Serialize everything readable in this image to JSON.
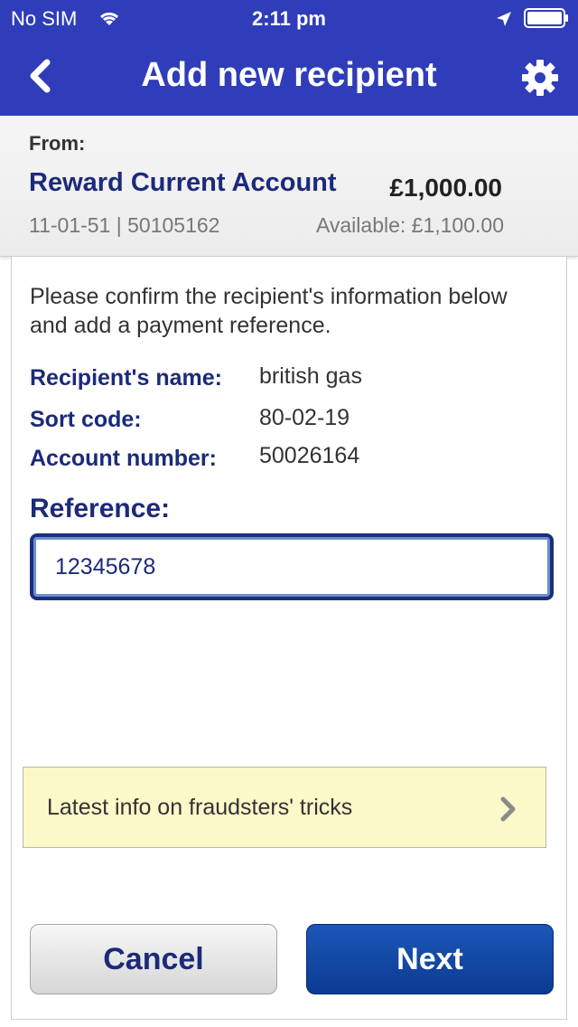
{
  "status_bar": {
    "carrier": "No SIM",
    "time": "2:11 pm",
    "icons": [
      "wifi-icon",
      "location-icon",
      "battery-icon"
    ]
  },
  "nav": {
    "title": "Add new recipient",
    "back_icon": "chevron-left-icon",
    "settings_icon": "gear-icon"
  },
  "from": {
    "label": "From:",
    "account_name": "Reward Current Account",
    "balance": "£1,000.00",
    "sort_and_number": "11-01-51 | 50105162",
    "available": "Available: £1,100.00"
  },
  "content": {
    "intro": "Please confirm the recipient's information below and add a payment reference.",
    "recipient_name_label": "Recipient's name:",
    "recipient_name_value": "british gas",
    "sort_code_label": "Sort code:",
    "sort_code_value": "80-02-19",
    "account_number_label": "Account number:",
    "account_number_value": "50026164",
    "reference_label": "Reference:",
    "reference_value": "12345678"
  },
  "fraud_banner": {
    "text": "Latest info on fraudsters' tricks"
  },
  "actions": {
    "cancel_label": "Cancel",
    "next_label": "Next"
  },
  "colors": {
    "header_blue": "#2f3dba",
    "label_navy": "#1b2a7a",
    "next_button_blue": "#0b3b92",
    "banner_yellow": "#fbf8c9"
  }
}
